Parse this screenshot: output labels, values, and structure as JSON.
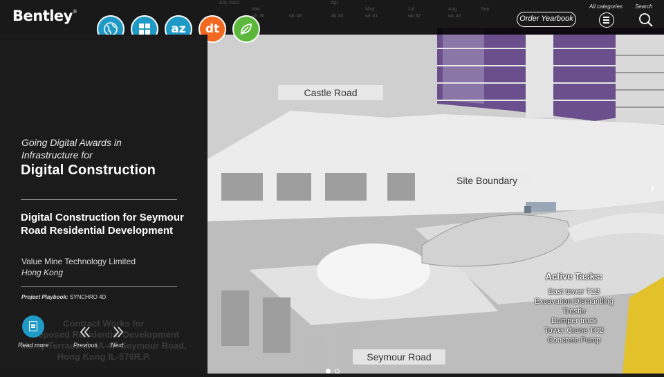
{
  "brand": {
    "name": "Bentley",
    "mark": "®"
  },
  "categories": [
    {
      "name": "globe-icon",
      "color": "#1f9ac7"
    },
    {
      "name": "grid-icon",
      "color": "#1f9ac7"
    },
    {
      "name": "az-icon",
      "label": "az",
      "color": "#1f9ac7"
    },
    {
      "name": "dt-icon",
      "label": "dt",
      "color": "#f26a21"
    },
    {
      "name": "leaf-icon",
      "color": "#5cb83c"
    }
  ],
  "timeline": {
    "labels": [
      "July 2020",
      "Mar",
      "Apr",
      "May",
      "Jul",
      "Aug",
      "Sep"
    ],
    "weeks": [
      "wk 36",
      "wk 48",
      "wk 40",
      "wk 41",
      "wk 32",
      "wk 43"
    ]
  },
  "header": {
    "order_label": "Order Yearbook",
    "all_categories": "All categories",
    "search": "Search"
  },
  "panel": {
    "award_line1": "Going Digital Awards in",
    "award_line2": "Infrastructure for",
    "award_title": "Digital Construction",
    "project_title": "Digital Construction for Seymour Road Residential Development",
    "company": "Value Mine Technology Limited",
    "location": "Hong Kong",
    "playbook_label": "Project Playbook:",
    "playbook_value": "SYNCHRO 4D",
    "behind_text": [
      "Contract Works for",
      "Proposed Residential Development",
      "Merry Terrace at 4A-4P Seymour Road,",
      "Hong Kong IL-576R.P."
    ],
    "read_more": "Read more",
    "previous": "Previous",
    "next": "Next"
  },
  "model_labels": {
    "castle": "Castle Road",
    "site": "Site Boundary",
    "seymour": "Seymour Road"
  },
  "active_tasks": {
    "title": "Active Tasks:",
    "items": [
      "East tower T1B",
      "Excavation Dismantling",
      "Trestle",
      "Dumper truck",
      "Tower Crane TC2",
      "Concrete Pump"
    ]
  },
  "pagination": {
    "pages": 2,
    "current": 1
  }
}
